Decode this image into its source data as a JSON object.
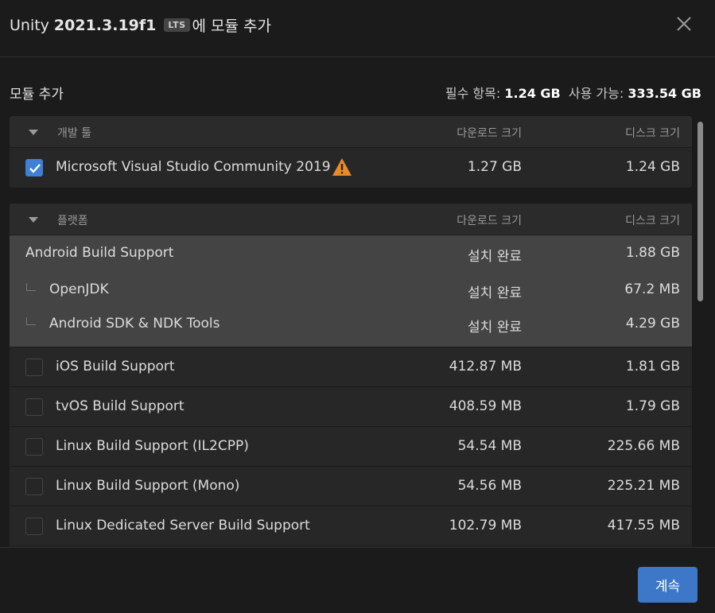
{
  "window": {
    "title_prefix": "Unity",
    "version": "2021.3.19f1",
    "lts_badge": "LTS",
    "title_suffix": "에 모듈 추가"
  },
  "subheader": {
    "title": "모듈 추가",
    "required_label": "필수 항목:",
    "required_value": "1.24 GB",
    "available_label": "사용 가능:",
    "available_value": "333.54 GB"
  },
  "dev_tools": {
    "name": "개발 툴",
    "col_download": "다운로드 크기",
    "col_disk": "디스크 크기",
    "items": [
      {
        "label": "Microsoft Visual Studio Community 2019",
        "download": "1.27 GB",
        "disk": "1.24 GB",
        "checked": true,
        "icon": "warning-icon"
      }
    ]
  },
  "platforms": {
    "name": "플랫폼",
    "col_download": "다운로드 크기",
    "col_disk": "디스크 크기",
    "installed": [
      {
        "label": "Android Build Support",
        "download": "설치 완료",
        "disk": "1.88 GB"
      },
      {
        "label": "OpenJDK",
        "download": "설치 완료",
        "disk": "67.2 MB"
      },
      {
        "label": "Android SDK & NDK Tools",
        "download": "설치 완료",
        "disk": "4.29 GB"
      }
    ],
    "items": [
      {
        "label": "iOS Build Support",
        "download": "412.87 MB",
        "disk": "1.81 GB",
        "checked": false
      },
      {
        "label": "tvOS Build Support",
        "download": "408.59 MB",
        "disk": "1.79 GB",
        "checked": false
      },
      {
        "label": "Linux Build Support (IL2CPP)",
        "download": "54.54 MB",
        "disk": "225.66 MB",
        "checked": false
      },
      {
        "label": "Linux Build Support (Mono)",
        "download": "54.56 MB",
        "disk": "225.21 MB",
        "checked": false
      },
      {
        "label": "Linux Dedicated Server Build Support",
        "download": "102.79 MB",
        "disk": "417.55 MB",
        "checked": false
      }
    ]
  },
  "footer": {
    "continue_label": "계속"
  },
  "colors": {
    "accent": "#3d78c8",
    "warning": "#e98a2a",
    "background": "#1b1b1b"
  }
}
